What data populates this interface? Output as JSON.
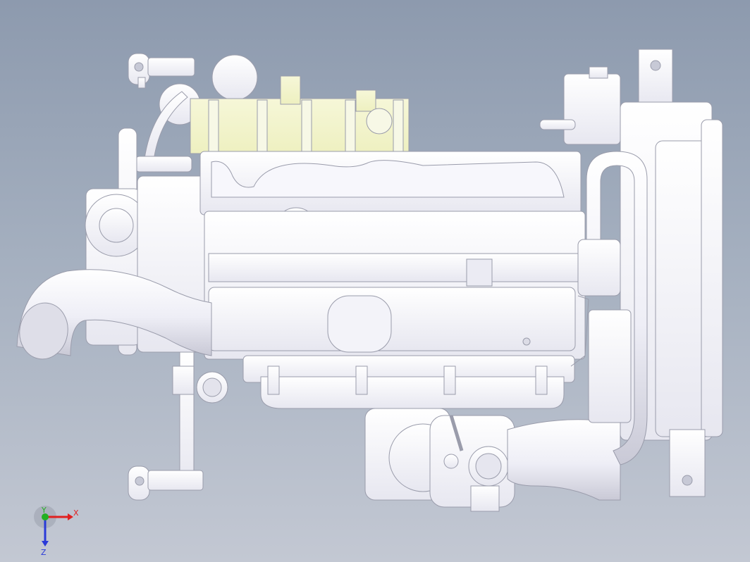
{
  "viewport": {
    "background_top": "#8d9aae",
    "background_bottom": "#c3c8d3",
    "part_color": "#f4f4fa",
    "part_edge_color": "#9a9cab",
    "highlight_color": "#f1f3c8"
  },
  "model": {
    "name_icon": "engine-model"
  },
  "triad": {
    "x_label": "X",
    "y_label": "Y",
    "z_label": "Z",
    "x_color": "#e02020",
    "y_color": "#22b022",
    "z_color": "#2a3ad8"
  }
}
